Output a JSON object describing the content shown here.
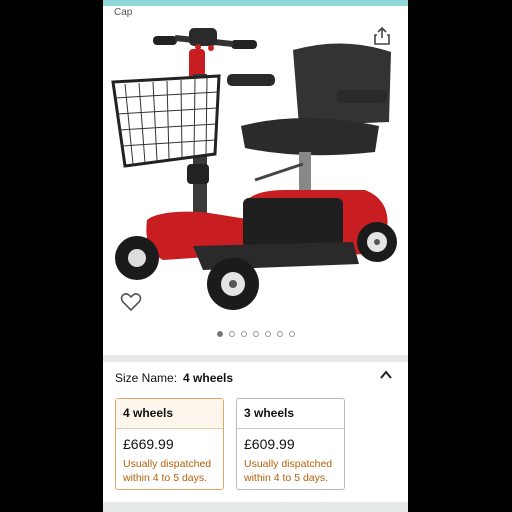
{
  "header": {
    "brand_label": "Cap"
  },
  "colors": {
    "scooter_red": "#c81e22",
    "accent_orange": "#e0a868",
    "dispatch_text": "#b3610a"
  },
  "gallery": {
    "image_count": 7,
    "active_index": 0
  },
  "size_selector": {
    "label": "Size Name:",
    "selected_value": "4 wheels",
    "options": [
      {
        "name": "4 wheels",
        "price": "£669.99",
        "availability": "Usually dispatched within 4 to 5 days.",
        "selected": true
      },
      {
        "name": "3 wheels",
        "price": "£609.99",
        "availability": "Usually dispatched within 4 to 5 days.",
        "selected": false
      }
    ]
  }
}
